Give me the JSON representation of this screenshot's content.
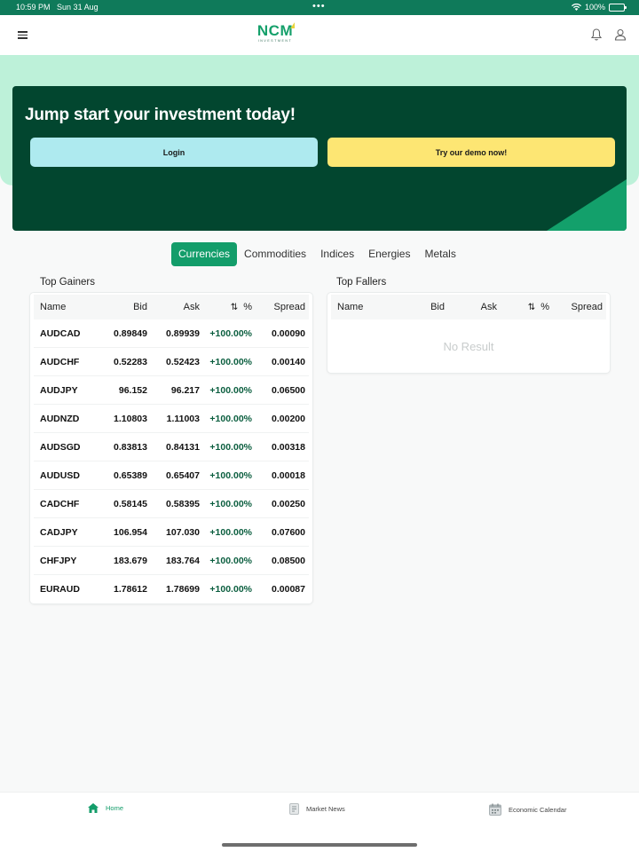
{
  "status_bar": {
    "time": "10:59 PM",
    "date": "Sun 31 Aug",
    "battery": "100%"
  },
  "header": {
    "logo_text": "NCM",
    "logo_sub": "INVESTMENT"
  },
  "hero": {
    "title": "Jump start your investment today!",
    "login_label": "Login",
    "demo_label": "Try our demo now!"
  },
  "tabs": [
    "Currencies",
    "Commodities",
    "Indices",
    "Energies",
    "Metals"
  ],
  "active_tab": "Currencies",
  "columns": {
    "name": "Name",
    "bid": "Bid",
    "ask": "Ask",
    "pct": "%",
    "spread": "Spread"
  },
  "top_gainers": {
    "title": "Top Gainers",
    "rows": [
      {
        "name": "AUDCAD",
        "bid": "0.89849",
        "ask": "0.89939",
        "pct": "+100.00%",
        "spread": "0.00090"
      },
      {
        "name": "AUDCHF",
        "bid": "0.52283",
        "ask": "0.52423",
        "pct": "+100.00%",
        "spread": "0.00140"
      },
      {
        "name": "AUDJPY",
        "bid": "96.152",
        "ask": "96.217",
        "pct": "+100.00%",
        "spread": "0.06500"
      },
      {
        "name": "AUDNZD",
        "bid": "1.10803",
        "ask": "1.11003",
        "pct": "+100.00%",
        "spread": "0.00200"
      },
      {
        "name": "AUDSGD",
        "bid": "0.83813",
        "ask": "0.84131",
        "pct": "+100.00%",
        "spread": "0.00318"
      },
      {
        "name": "AUDUSD",
        "bid": "0.65389",
        "ask": "0.65407",
        "pct": "+100.00%",
        "spread": "0.00018"
      },
      {
        "name": "CADCHF",
        "bid": "0.58145",
        "ask": "0.58395",
        "pct": "+100.00%",
        "spread": "0.00250"
      },
      {
        "name": "CADJPY",
        "bid": "106.954",
        "ask": "107.030",
        "pct": "+100.00%",
        "spread": "0.07600"
      },
      {
        "name": "CHFJPY",
        "bid": "183.679",
        "ask": "183.764",
        "pct": "+100.00%",
        "spread": "0.08500"
      },
      {
        "name": "EURAUD",
        "bid": "1.78612",
        "ask": "1.78699",
        "pct": "+100.00%",
        "spread": "0.00087"
      }
    ]
  },
  "top_fallers": {
    "title": "Top Fallers",
    "empty_text": "No Result"
  },
  "bottom_nav": {
    "home": "Home",
    "news": "Market News",
    "calendar": "Economic Calendar"
  },
  "colors": {
    "brand_green": "#139d6a",
    "hero_dark": "#02462f",
    "hero_light": "#bdf1d9",
    "login_bg": "#aeeaef",
    "demo_bg": "#fde673"
  }
}
